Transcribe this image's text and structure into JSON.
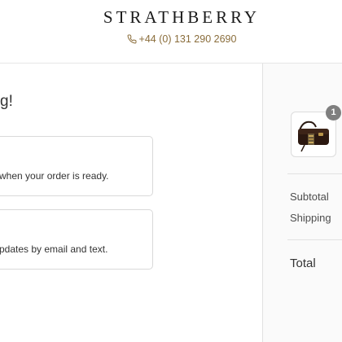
{
  "header": {
    "brand": "STRATHBERRY",
    "phone": "+44 (0) 131 290 2690",
    "phone_icon": "phone-icon"
  },
  "main": {
    "heading_fragment": "g!",
    "cards": [
      {
        "text": "when your order is ready."
      },
      {
        "text": "pdates by email and text."
      }
    ]
  },
  "sidebar": {
    "product_thumbnail": "handbag-thumbnail",
    "quantity_badge": "1",
    "subtotal_label": "Subtotal",
    "shipping_label": "Shipping",
    "total_label": "Total"
  },
  "colors": {
    "accent_gold": "#8a6d3b",
    "badge_gray": "#7f7f7f",
    "sidebar_bg": "#fafafa",
    "border": "#d9d9d9"
  }
}
